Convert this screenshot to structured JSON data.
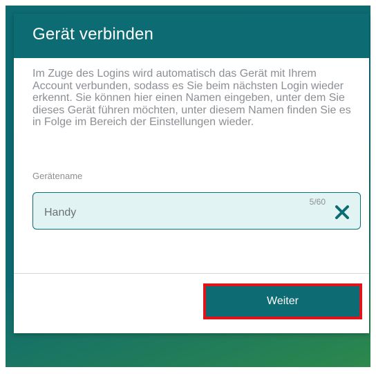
{
  "dialog": {
    "title": "Gerät verbinden",
    "description": "Im Zuge des Logins wird automatisch das Gerät mit Ihrem Account verbunden, sodass es Sie beim nächsten Login wieder erkennt. Sie können hier einen Namen eingeben, unter dem Sie dieses Gerät führen möchten, unter diesem Namen finden Sie es in Folge im Bereich der Einstellungen wieder.",
    "field_label": "Gerätename",
    "input_value": "Handy",
    "char_count": "5/60",
    "clear_icon": "close-icon",
    "next_label": "Weiter"
  },
  "colors": {
    "accent": "#0d6b73",
    "input_background": "#e2f3f3",
    "highlight": "#e0141b"
  }
}
